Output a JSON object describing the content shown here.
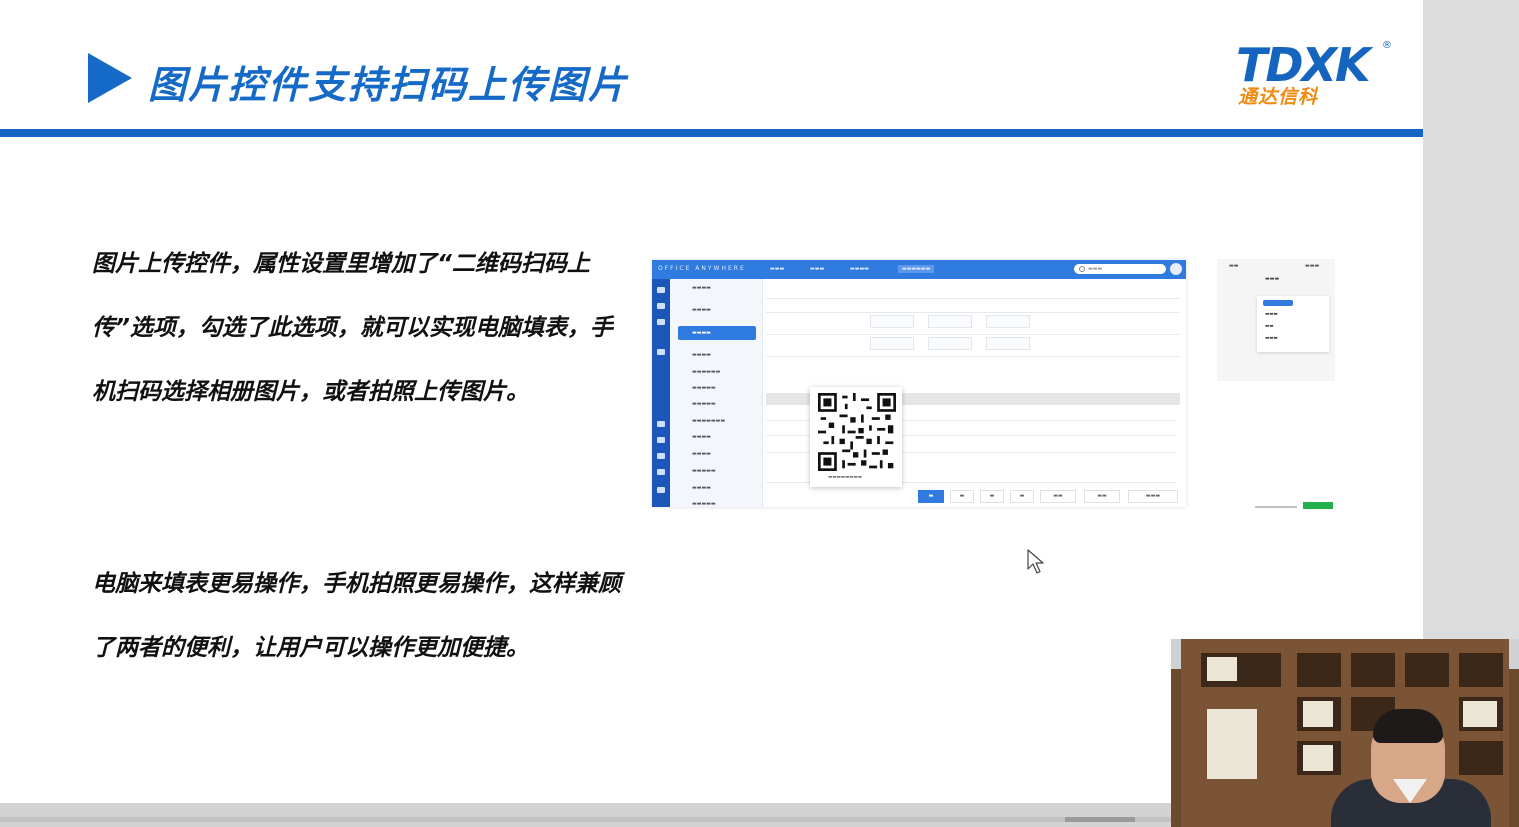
{
  "slide": {
    "title": "图片控件支持扫码上传图片",
    "logo_text": "TDXK",
    "logo_reg": "®",
    "logo_cn": "通达信科",
    "paragraph1": "图片上传控件，属性设置里增加了“二维码扫码上传”选项，勾选了此选项，就可以实现电脑填表，手机扫码选择相册图片，或者拍照上传图片。",
    "paragraph2": "电脑来填表更易操作，手机拍照更易操作，这样兼顾了两者的便利，让用户可以操作更加便捷。"
  },
  "colors": {
    "accent_blue": "#1569c7",
    "logo_orange": "#f08a12"
  },
  "icons": [
    "play-triangle-icon",
    "qr-code-icon",
    "mouse-cursor-icon"
  ]
}
